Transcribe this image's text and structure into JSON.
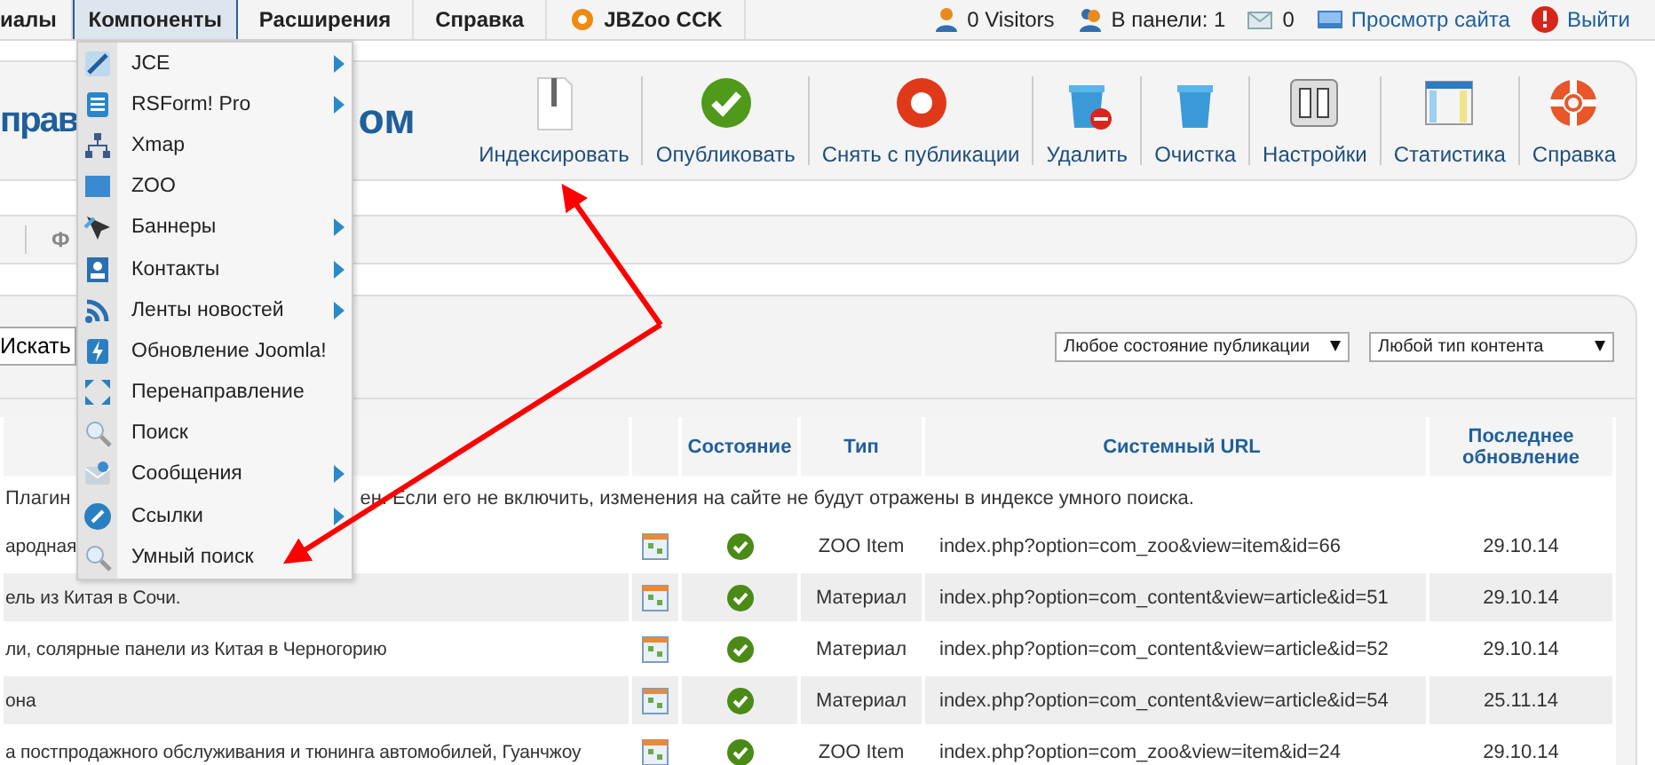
{
  "top_menu": [
    {
      "label": "иалы",
      "selected": false
    },
    {
      "label": "Компоненты",
      "selected": true
    },
    {
      "label": "Расширения",
      "selected": false
    },
    {
      "label": "Справка",
      "selected": false
    },
    {
      "label": "JBZoo CCK",
      "selected": false
    }
  ],
  "status": {
    "visitors": "0 Visitors",
    "in_panel": "В панели: 1",
    "messages": "0",
    "view_site": "Просмотр сайта",
    "logout": "Выйти"
  },
  "components_menu": [
    {
      "label": "JCE",
      "submenu": true
    },
    {
      "label": "RSForm! Pro",
      "submenu": true
    },
    {
      "label": "Xmap",
      "submenu": false
    },
    {
      "label": "ZOO",
      "submenu": false
    },
    {
      "label": "Баннеры",
      "submenu": true
    },
    {
      "label": "Контакты",
      "submenu": true
    },
    {
      "label": "Ленты новостей",
      "submenu": true
    },
    {
      "label": "Обновление Joomla!",
      "submenu": false
    },
    {
      "label": "Перенаправление",
      "submenu": false
    },
    {
      "label": "Поиск",
      "submenu": false
    },
    {
      "label": "Сообщения",
      "submenu": true
    },
    {
      "label": "Ссылки",
      "submenu": true
    },
    {
      "label": "Умный поиск",
      "submenu": false
    }
  ],
  "page_title_parts": [
    "прав",
    "ом"
  ],
  "toolbar": [
    "Индексировать",
    "Опубликовать",
    "Снять с публикации",
    "Удалить",
    "Очистка",
    "Настройки",
    "Статистика",
    "Справка"
  ],
  "subnav_text": "Ф",
  "search_button": "Искать",
  "filters": [
    "Любое состояние публикации",
    "Любой тип контента"
  ],
  "table": {
    "columns": [
      "Состояние",
      "Тип",
      "Системный URL",
      "Последнее обновление"
    ],
    "notice_parts": [
      "Плагин",
      "ен. Если его не включить, изменения на сайте не будут отражены в индексе умного поиска."
    ],
    "rows": [
      {
        "title": "ародная",
        "published": true,
        "type": "ZOO Item",
        "url": "index.php?option=com_zoo&view=item&id=66",
        "date": "29.10.14"
      },
      {
        "title": "ель из Китая в Сочи.",
        "published": true,
        "type": "Материал",
        "url": "index.php?option=com_content&view=article&id=51",
        "date": "29.10.14"
      },
      {
        "title": "ли, солярные панели из Китая в Черногорию",
        "published": true,
        "type": "Материал",
        "url": "index.php?option=com_content&view=article&id=52",
        "date": "29.10.14"
      },
      {
        "title": "она",
        "published": true,
        "type": "Материал",
        "url": "index.php?option=com_content&view=article&id=54",
        "date": "25.11.14"
      },
      {
        "title": "а постпродажного обслуживания и тюнинга автомобилей, Гуанчжоу",
        "published": true,
        "type": "ZOO Item",
        "url": "index.php?option=com_zoo&view=item&id=24",
        "date": "29.10.14"
      }
    ]
  }
}
